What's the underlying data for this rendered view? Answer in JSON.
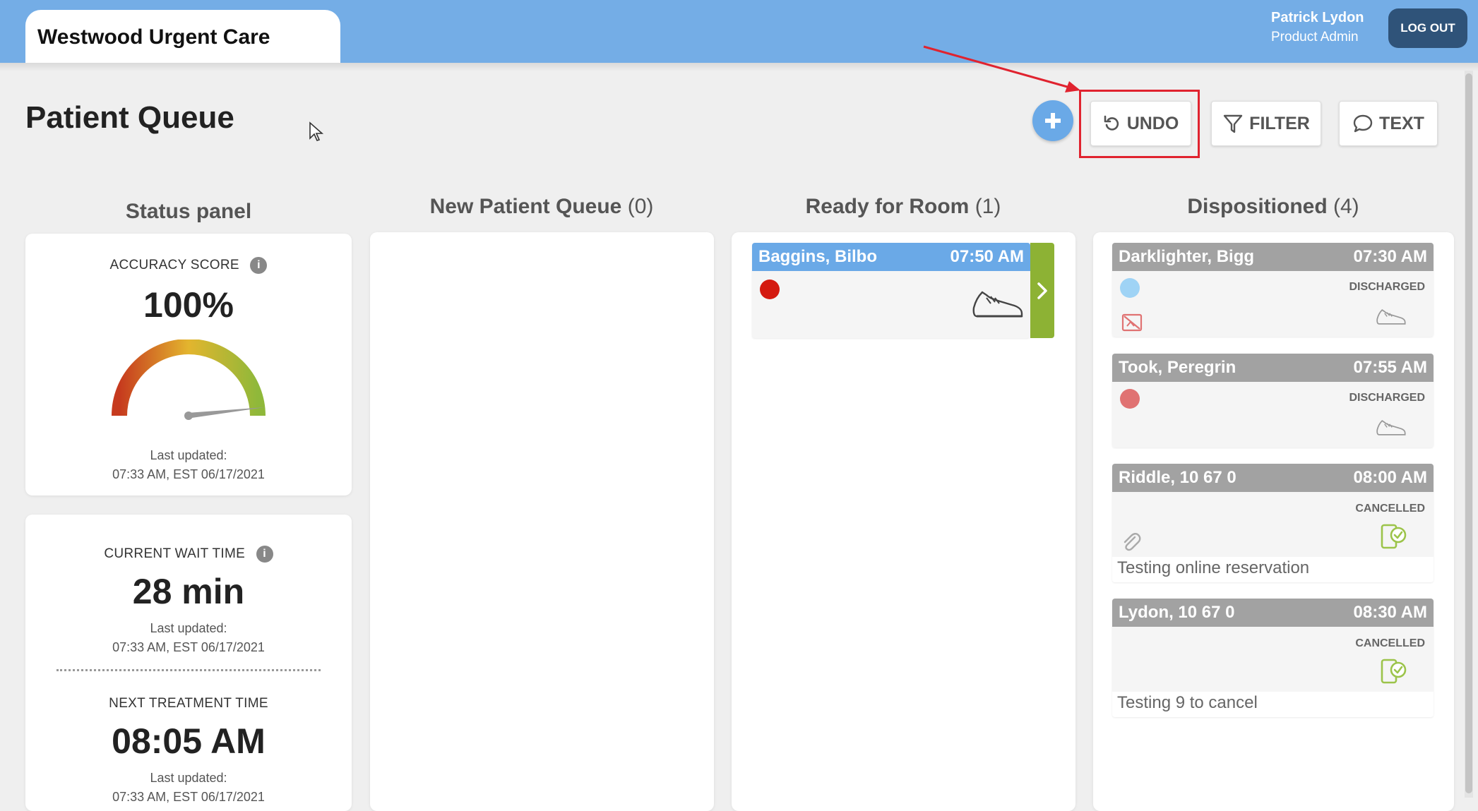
{
  "header": {
    "site_title": "Westwood Urgent Care",
    "user_name": "Patrick Lydon",
    "user_role": "Product Admin",
    "logout_label": "LOG OUT",
    "bar_color": "#74ade6"
  },
  "page": {
    "title": "Patient Queue"
  },
  "toolbar": {
    "add_label": "+",
    "undo_label": "UNDO",
    "filter_label": "FILTER",
    "text_label": "TEXT"
  },
  "status_panel": {
    "heading": "Status panel",
    "accuracy": {
      "label": "ACCURACY SCORE",
      "value": "100%",
      "updated_label": "Last updated:",
      "updated_time": "07:33 AM, EST 06/17/2021"
    },
    "wait_time": {
      "label": "CURRENT WAIT TIME",
      "value": "28 min",
      "updated_label": "Last updated:",
      "updated_time": "07:33 AM, EST 06/17/2021"
    },
    "next_treatment": {
      "label": "NEXT TREATMENT TIME",
      "value": "08:05 AM",
      "updated_label": "Last updated:",
      "updated_time": "07:33 AM, EST 06/17/2021"
    }
  },
  "columns": {
    "new_queue": {
      "title": "New Patient Queue",
      "count": "(0)"
    },
    "ready_room": {
      "title": "Ready for Room",
      "count": "(1)"
    },
    "dispositioned": {
      "title": "Dispositioned",
      "count": "(4)"
    }
  },
  "ready_cards": [
    {
      "name": "Baggins, Bilbo",
      "time": "07:50 AM",
      "dot_color": "#d41a10",
      "icon": "sneaker-icon"
    }
  ],
  "dispositioned_cards": [
    {
      "name": "Darklighter, Bigg",
      "time": "07:30 AM",
      "status": "DISCHARGED",
      "dot_color": "#9fd3f5",
      "icon": "sneaker-icon",
      "secondary_icon": "no-image-icon"
    },
    {
      "name": "Took, Peregrin",
      "time": "07:55 AM",
      "status": "DISCHARGED",
      "dot_color": "#e07272",
      "icon": "sneaker-icon"
    },
    {
      "name": "Riddle, 10 67 0",
      "time": "08:00 AM",
      "status": "CANCELLED",
      "note": "Testing online reservation",
      "icon": "mobile-check-icon",
      "secondary_icon": "paperclip-icon"
    },
    {
      "name": "Lydon, 10 67 0",
      "time": "08:30 AM",
      "status": "CANCELLED",
      "note": "Testing 9 to cancel",
      "icon": "mobile-check-icon"
    }
  ]
}
